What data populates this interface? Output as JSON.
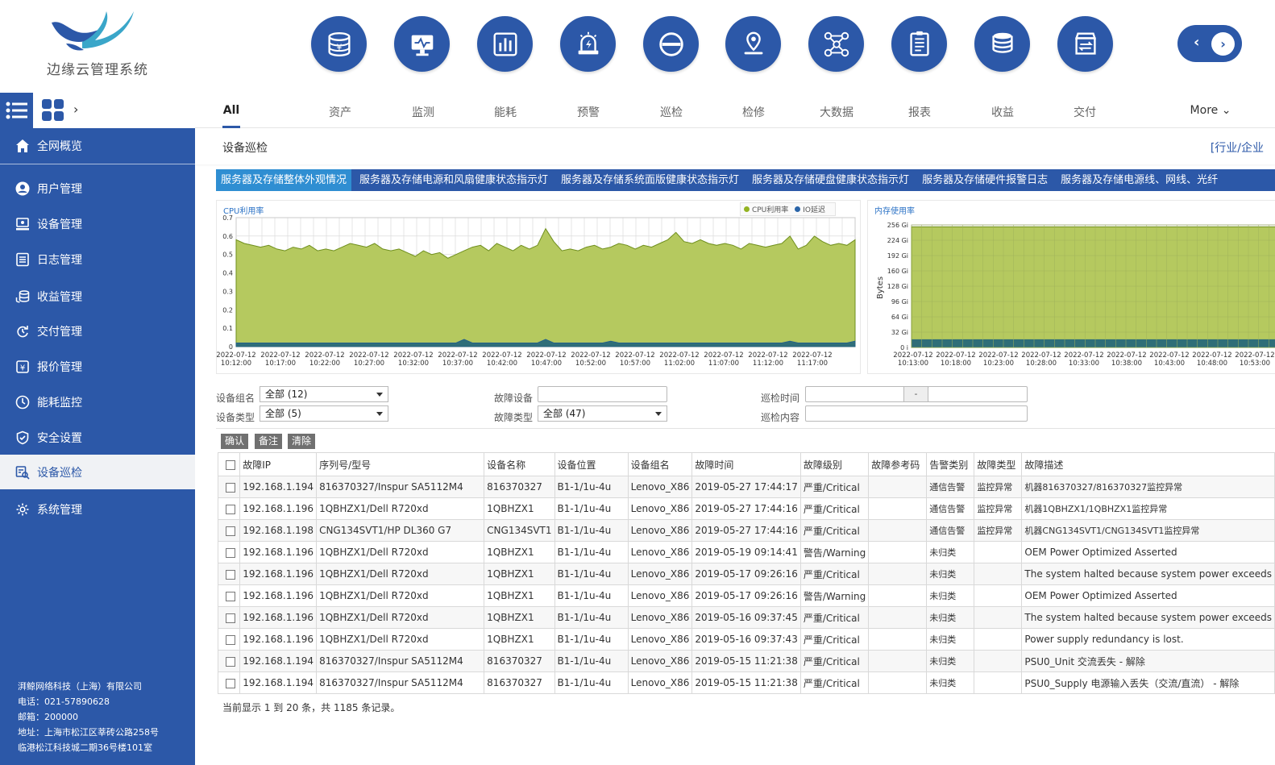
{
  "app": {
    "title": "边缘云管理系统"
  },
  "modules": [
    {
      "icon": "asset-coins-icon"
    },
    {
      "icon": "monitor-icon"
    },
    {
      "icon": "bar-chart-icon"
    },
    {
      "icon": "alarm-icon"
    },
    {
      "icon": "no-entry-icon"
    },
    {
      "icon": "location-pin-icon"
    },
    {
      "icon": "network-nodes-icon"
    },
    {
      "icon": "report-document-icon"
    },
    {
      "icon": "database-icon"
    },
    {
      "icon": "delivery-box-icon"
    }
  ],
  "menu_tabs": [
    "All",
    "资产",
    "监测",
    "能耗",
    "预警",
    "巡检",
    "检修",
    "大数据",
    "报表",
    "收益",
    "交付"
  ],
  "menu_more": "More",
  "sidebar": {
    "items": [
      {
        "label": "全网概览",
        "icon": "home-icon"
      },
      {
        "label": "用户管理",
        "icon": "user-icon"
      },
      {
        "label": "设备管理",
        "icon": "device-icon"
      },
      {
        "label": "日志管理",
        "icon": "log-icon"
      },
      {
        "label": "收益管理",
        "icon": "coins-icon"
      },
      {
        "label": "交付管理",
        "icon": "delivery-icon"
      },
      {
        "label": "报价管理",
        "icon": "quote-icon"
      },
      {
        "label": "能耗监控",
        "icon": "energy-icon"
      },
      {
        "label": "安全设置",
        "icon": "shield-icon"
      },
      {
        "label": "设备巡检",
        "icon": "inspection-icon"
      },
      {
        "label": "系统管理",
        "icon": "gear-icon"
      }
    ],
    "active_index": 9,
    "company": {
      "name": "湃鲸网络科技（上海）有限公司",
      "phone": "电话：021-57890628",
      "postcode": "邮箱：200000",
      "address1": "地址：上海市松江区莘砖公路258号",
      "address2": "临港松江科技城二期36号楼101室"
    }
  },
  "page": {
    "title": "设备巡检",
    "crumb_right": "[行业/企业"
  },
  "subtabs": [
    "服务器及存储整体外观情况",
    "服务器及存储电源和风扇健康状态指示灯",
    "服务器及存储系统面版健康状态指示灯",
    "服务器及存储硬盘健康状态指示灯",
    "服务器及存储硬件报警日志",
    "服务器及存储电源线、网线、光纤"
  ],
  "colors": {
    "primary": "#2c58a8",
    "active_tab": "#2f8ed2",
    "cpu_area": "#b5c95f",
    "io_area": "#2f6e78"
  },
  "chart_data": [
    {
      "type": "area",
      "title": "CPU利用率",
      "legend": [
        "CPU利用率",
        "IO延迟"
      ],
      "legend_placement": "top-right",
      "ylim": [
        0,
        0.7
      ],
      "y_ticks": [
        "0.7",
        "0.6",
        "0.5",
        "0.4",
        "0.3",
        "0.2",
        "0.1",
        "0"
      ],
      "x_labels": [
        [
          "2022-07-12",
          "10:12:00"
        ],
        [
          "2022-07-12",
          "10:17:00"
        ],
        [
          "2022-07-12",
          "10:22:00"
        ],
        [
          "2022-07-12",
          "10:27:00"
        ],
        [
          "2022-07-12",
          "10:32:00"
        ],
        [
          "2022-07-12",
          "10:37:00"
        ],
        [
          "2022-07-12",
          "10:42:00"
        ],
        [
          "2022-07-12",
          "10:47:00"
        ],
        [
          "2022-07-12",
          "10:52:00"
        ],
        [
          "2022-07-12",
          "10:57:00"
        ],
        [
          "2022-07-12",
          "11:02:00"
        ],
        [
          "2022-07-12",
          "11:07:00"
        ],
        [
          "2022-07-12",
          "11:12:00"
        ],
        [
          "2022-07-12",
          "11:17:00"
        ]
      ],
      "series": [
        {
          "name": "CPU利用率",
          "values": [
            0.58,
            0.56,
            0.55,
            0.54,
            0.55,
            0.53,
            0.52,
            0.54,
            0.53,
            0.55,
            0.52,
            0.53,
            0.52,
            0.54,
            0.56,
            0.55,
            0.54,
            0.56,
            0.53,
            0.52,
            0.53,
            0.51,
            0.49,
            0.52,
            0.5,
            0.51,
            0.48,
            0.5,
            0.52,
            0.54,
            0.55,
            0.52,
            0.56,
            0.54,
            0.52,
            0.55,
            0.53,
            0.55,
            0.64,
            0.57,
            0.52,
            0.53,
            0.52,
            0.54,
            0.55,
            0.53,
            0.54,
            0.56,
            0.55,
            0.53,
            0.55,
            0.54,
            0.56,
            0.58,
            0.62,
            0.57,
            0.56,
            0.58,
            0.56,
            0.55,
            0.56,
            0.55,
            0.53,
            0.56,
            0.55,
            0.54,
            0.55,
            0.56,
            0.6,
            0.53,
            0.55,
            0.6,
            0.57,
            0.55,
            0.56,
            0.55,
            0.58
          ]
        },
        {
          "name": "IO延迟",
          "values": [
            0.02,
            0.02,
            0.02,
            0.02,
            0.02,
            0.02,
            0.02,
            0.02,
            0.02,
            0.02,
            0.02,
            0.02,
            0.02,
            0.02,
            0.02,
            0.02,
            0.02,
            0.02,
            0.02,
            0.02,
            0.02,
            0.02,
            0.02,
            0.02,
            0.02,
            0.02,
            0.02,
            0.02,
            0.04,
            0.02,
            0.02,
            0.02,
            0.02,
            0.02,
            0.02,
            0.02,
            0.02,
            0.02,
            0.04,
            0.02,
            0.02,
            0.02,
            0.02,
            0.02,
            0.02,
            0.02,
            0.03,
            0.02,
            0.02,
            0.02,
            0.02,
            0.02,
            0.02,
            0.02,
            0.02,
            0.02,
            0.02,
            0.02,
            0.02,
            0.02,
            0.02,
            0.02,
            0.02,
            0.02,
            0.02,
            0.02,
            0.02,
            0.02,
            0.03,
            0.02,
            0.02,
            0.02,
            0.02,
            0.02,
            0.02,
            0.02,
            0.03
          ]
        }
      ]
    },
    {
      "type": "area",
      "title": "内存使用率",
      "ylabel": "Bytes",
      "ylim": [
        0,
        256
      ],
      "y_ticks": [
        "256 Gi",
        "224 Gi",
        "192 Gi",
        "160 Gi",
        "128 Gi",
        "96 Gi",
        "64 Gi",
        "32 Gi",
        "0 i"
      ],
      "x_labels": [
        [
          "2022-07-12",
          "10:13:00"
        ],
        [
          "2022-07-12",
          "10:18:00"
        ],
        [
          "2022-07-12",
          "10:23:00"
        ],
        [
          "2022-07-12",
          "10:28:00"
        ],
        [
          "2022-07-12",
          "10:33:00"
        ],
        [
          "2022-07-12",
          "10:38:00"
        ],
        [
          "2022-07-12",
          "10:43:00"
        ],
        [
          "2022-07-12",
          "10:48:00"
        ],
        [
          "2022-07-12",
          "10:53:00"
        ]
      ],
      "series": [
        {
          "name": "total",
          "values": [
            252,
            252
          ]
        },
        {
          "name": "used",
          "values": [
            17,
            17
          ]
        }
      ]
    }
  ],
  "filters": {
    "group_label": "设备组名",
    "group_value": "全部 (12)",
    "type_label": "设备类型",
    "type_value": "全部 (5)",
    "fault_device_label": "故障设备",
    "fault_device_value": "",
    "fault_type_label": "故障类型",
    "fault_type_value": "全部 (47)",
    "time_label": "巡检时间",
    "time_sep": "-",
    "content_label": "巡检内容"
  },
  "actions": {
    "confirm": "确认",
    "note": "备注",
    "clear": "清除"
  },
  "table": {
    "columns": [
      "故障IP",
      "序列号/型号",
      "设备名称",
      "设备位置",
      "设备组名",
      "故障时间",
      "故障级别",
      "故障参考码",
      "告警类别",
      "故障类型",
      "故障描述"
    ],
    "rows": [
      [
        "192.168.1.194",
        "816370327/Inspur SA5112M4",
        "816370327",
        "B1-1/1u-4u",
        "Lenovo_X86",
        "2019-05-27 17:44:17",
        "严重/Critical",
        "",
        "通信告警",
        "监控异常",
        "机器816370327/816370327监控异常"
      ],
      [
        "192.168.1.196",
        "1QBHZX1/Dell R720xd",
        "1QBHZX1",
        "B1-1/1u-4u",
        "Lenovo_X86",
        "2019-05-27 17:44:16",
        "严重/Critical",
        "",
        "通信告警",
        "监控异常",
        "机器1QBHZX1/1QBHZX1监控异常"
      ],
      [
        "192.168.1.198",
        "CNG134SVT1/HP DL360 G7",
        "CNG134SVT1",
        "B1-1/1u-4u",
        "Lenovo_X86",
        "2019-05-27 17:44:16",
        "严重/Critical",
        "",
        "通信告警",
        "监控异常",
        "机器CNG134SVT1/CNG134SVT1监控异常"
      ],
      [
        "192.168.1.196",
        "1QBHZX1/Dell R720xd",
        "1QBHZX1",
        "B1-1/1u-4u",
        "Lenovo_X86",
        "2019-05-19 09:14:41",
        "警告/Warning",
        "",
        "未归类",
        "",
        "OEM Power Optimized Asserted"
      ],
      [
        "192.168.1.196",
        "1QBHZX1/Dell R720xd",
        "1QBHZX1",
        "B1-1/1u-4u",
        "Lenovo_X86",
        "2019-05-17 09:26:16",
        "严重/Critical",
        "",
        "未归类",
        "",
        "The system halted because system power exceeds"
      ],
      [
        "192.168.1.196",
        "1QBHZX1/Dell R720xd",
        "1QBHZX1",
        "B1-1/1u-4u",
        "Lenovo_X86",
        "2019-05-17 09:26:16",
        "警告/Warning",
        "",
        "未归类",
        "",
        "OEM Power Optimized Asserted"
      ],
      [
        "192.168.1.196",
        "1QBHZX1/Dell R720xd",
        "1QBHZX1",
        "B1-1/1u-4u",
        "Lenovo_X86",
        "2019-05-16 09:37:45",
        "严重/Critical",
        "",
        "未归类",
        "",
        "The system halted because system power exceeds"
      ],
      [
        "192.168.1.196",
        "1QBHZX1/Dell R720xd",
        "1QBHZX1",
        "B1-1/1u-4u",
        "Lenovo_X86",
        "2019-05-16 09:37:43",
        "严重/Critical",
        "",
        "未归类",
        "",
        "Power supply redundancy is lost."
      ],
      [
        "192.168.1.194",
        "816370327/Inspur SA5112M4",
        "816370327",
        "B1-1/1u-4u",
        "Lenovo_X86",
        "2019-05-15 11:21:38",
        "严重/Critical",
        "",
        "未归类",
        "",
        "PSU0_Unit 交流丢失 - 解除"
      ],
      [
        "192.168.1.194",
        "816370327/Inspur SA5112M4",
        "816370327",
        "B1-1/1u-4u",
        "Lenovo_X86",
        "2019-05-15 11:21:38",
        "严重/Critical",
        "",
        "未归类",
        "",
        "PSU0_Supply 电源输入丢失（交流/直流） - 解除"
      ]
    ]
  },
  "pager": {
    "summary": "当前显示 1 到 20 条，共 1185 条记录。"
  }
}
